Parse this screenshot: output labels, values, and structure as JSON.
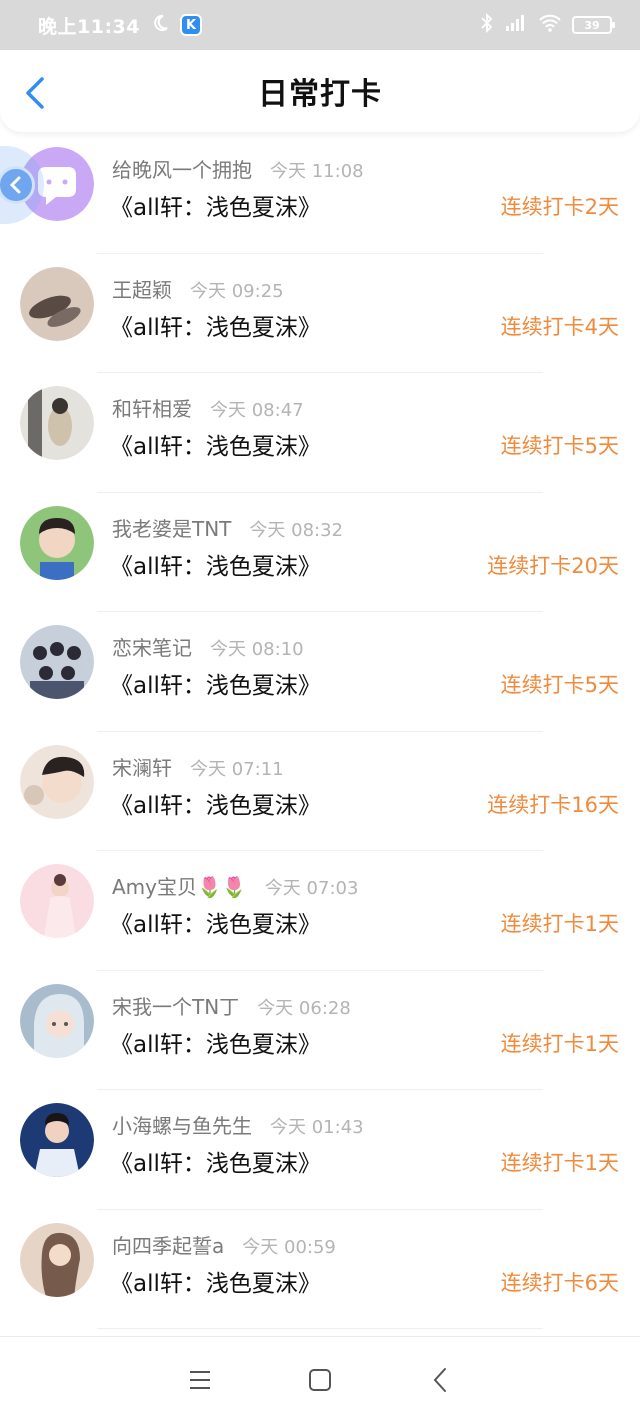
{
  "status_bar": {
    "time": "晚上11:34",
    "app_badge": "K",
    "battery": "39"
  },
  "header": {
    "title": "日常打卡"
  },
  "entries": [
    {
      "nickname": "给晚风一个拥抱",
      "time": "今天 11:08",
      "book": "《all轩：浅色夏沫》",
      "streak": "连续打卡2天",
      "avatar_color": "#c9a8f5"
    },
    {
      "nickname": "王超颖",
      "time": "今天 09:25",
      "book": "《all轩：浅色夏沫》",
      "streak": "连续打卡4天",
      "avatar_color": "#b8a394"
    },
    {
      "nickname": "和轩相爱",
      "time": "今天 08:47",
      "book": "《all轩：浅色夏沫》",
      "streak": "连续打卡5天",
      "avatar_color": "#8d8a83"
    },
    {
      "nickname": "我老婆是TNT",
      "time": "今天 08:32",
      "book": "《all轩：浅色夏沫》",
      "streak": "连续打卡20天",
      "avatar_color": "#7fb86a"
    },
    {
      "nickname": "恋宋笔记",
      "time": "今天 08:10",
      "book": "《all轩：浅色夏沫》",
      "streak": "连续打卡5天",
      "avatar_color": "#4e5a78"
    },
    {
      "nickname": "宋澜轩",
      "time": "今天 07:11",
      "book": "《all轩：浅色夏沫》",
      "streak": "连续打卡16天",
      "avatar_color": "#e6d6cf"
    },
    {
      "nickname": "Amy宝贝🌷🌷",
      "time": "今天 07:03",
      "book": "《all轩：浅色夏沫》",
      "streak": "连续打卡1天",
      "avatar_color": "#f6cfd6"
    },
    {
      "nickname": "宋我一个TN丁",
      "time": "今天 06:28",
      "book": "《all轩：浅色夏沫》",
      "streak": "连续打卡1天",
      "avatar_color": "#8fa3b8"
    },
    {
      "nickname": "小海螺与鱼先生",
      "time": "今天 01:43",
      "book": "《all轩：浅色夏沫》",
      "streak": "连续打卡1天",
      "avatar_color": "#2f4f8f"
    },
    {
      "nickname": "向四季起誓a",
      "time": "今天 00:59",
      "book": "《all轩：浅色夏沫》",
      "streak": "连续打卡6天",
      "avatar_color": "#c8a38c"
    }
  ],
  "colors": {
    "accent_orange": "#f08a3c",
    "back_blue": "#2f8ef0"
  }
}
